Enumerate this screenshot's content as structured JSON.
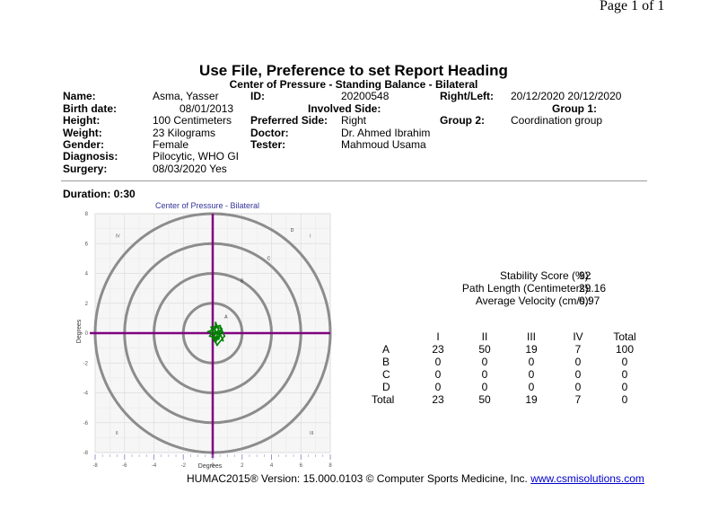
{
  "page": {
    "label": "Page 1 of 1"
  },
  "report": {
    "heading": "Use File, Preference to set Report Heading",
    "subheading": "Center of Pressure - Standing Balance - Bilateral"
  },
  "patient": {
    "name_label": "Name:",
    "name": "Asma, Yasser",
    "birth_label": "Birth date:",
    "birth": "08/01/2013",
    "height_label": "Height:",
    "height": "100 Centimeters",
    "weight_label": "Weight:",
    "weight": "23 Kilograms",
    "gender_label": "Gender:",
    "gender": "Female",
    "diagnosis_label": "Diagnosis:",
    "diagnosis": "Pilocytic, WHO GI",
    "surgery_label": "Surgery:",
    "surgery": "08/03/2020 Yes",
    "id_label": "ID:",
    "id": "20200548",
    "involved_label": "Involved Side:",
    "preferred_label": "Preferred Side:",
    "preferred": "Right",
    "doctor_label": "Doctor:",
    "doctor": "Dr. Ahmed Ibrahim",
    "tester_label": "Tester:",
    "tester": "Mahmoud Usama",
    "rightleft_label": "Right/Left:",
    "rightleft": "20/12/2020 20/12/2020",
    "group1_label": "Group 1:",
    "group2_label": "Group 2:",
    "group2": "Coordination group"
  },
  "test": {
    "duration": "Duration: 0:30"
  },
  "chart_data": {
    "type": "scatter",
    "title": "Center of Pressure - Bilateral",
    "xlabel": "Degrees",
    "ylabel": "Degrees",
    "xlim": [
      -8,
      8
    ],
    "ylim": [
      -8,
      8
    ],
    "x_ticks": [
      -8,
      -6,
      -4,
      -2,
      0,
      2,
      4,
      6,
      8
    ],
    "y_ticks": [
      -8,
      -6,
      -4,
      -2,
      0,
      2,
      4,
      6,
      8
    ],
    "ring_radii": [
      2,
      4,
      6,
      8
    ],
    "ring_labels": [
      "A",
      "B",
      "C",
      "D"
    ],
    "quadrant_labels": [
      "I",
      "II",
      "III",
      "IV"
    ],
    "grid": true,
    "series": [
      {
        "x": [
          0.3,
          0.1,
          -0.2,
          0.4,
          0.6,
          0.2,
          -0.1,
          0.5,
          0.8,
          0.3,
          0.0,
          0.4,
          0.7,
          0.2,
          0.1,
          0.5,
          -0.3,
          0.3,
          0.6,
          0.2
        ],
        "y": [
          0.0,
          0.3,
          -0.2,
          -0.4,
          0.1,
          -0.6,
          0.4,
          0.5,
          -0.2,
          -0.8,
          -0.3,
          0.2,
          -0.5,
          0.7,
          -0.5,
          -0.1,
          0.1,
          0.4,
          0.3,
          -0.3
        ]
      }
    ]
  },
  "colors": {
    "rings": "#8c8c8c",
    "axes": "#800080",
    "path": "#008000",
    "title": "#333399"
  },
  "stats": {
    "stability_label": "Stability Score (%):",
    "stability": "92",
    "path_label": "Path Length (Centimeters):",
    "path": "29.16",
    "velocity_label": "Average Velocity (cm/s):",
    "velocity": "0.97"
  },
  "zones": {
    "headers": [
      "I",
      "II",
      "III",
      "IV",
      "Total"
    ],
    "rows": [
      {
        "label": "A",
        "values": [
          "23",
          "50",
          "19",
          "7",
          "100"
        ]
      },
      {
        "label": "B",
        "values": [
          "0",
          "0",
          "0",
          "0",
          "0"
        ]
      },
      {
        "label": "C",
        "values": [
          "0",
          "0",
          "0",
          "0",
          "0"
        ]
      },
      {
        "label": "D",
        "values": [
          "0",
          "0",
          "0",
          "0",
          "0"
        ]
      },
      {
        "label": "Total",
        "values": [
          "23",
          "50",
          "19",
          "7",
          "0"
        ]
      }
    ]
  },
  "footer": {
    "text": "HUMAC2015® Version: 15.000.0103 © Computer Sports Medicine, Inc.",
    "link": "www.csmisolutions.com"
  }
}
